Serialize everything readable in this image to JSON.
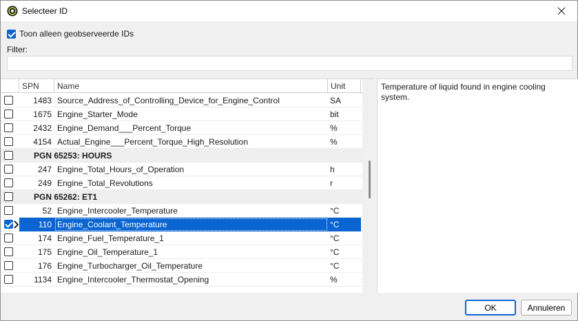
{
  "window": {
    "title": "Selecteer ID"
  },
  "options": {
    "only_observed_label": "Toon alleen geobserveerde IDs",
    "only_observed_checked": true
  },
  "filter": {
    "label": "Filter:",
    "value": ""
  },
  "grid": {
    "columns": {
      "spn": "SPN",
      "name": "Name",
      "unit": "Unit"
    },
    "rows": [
      {
        "kind": "item",
        "checked": false,
        "spn": "1483",
        "name": "Source_Address_of_Controlling_Device_for_Engine_Control",
        "unit": "SA"
      },
      {
        "kind": "item",
        "checked": false,
        "spn": "1675",
        "name": "Engine_Starter_Mode",
        "unit": "bit"
      },
      {
        "kind": "item",
        "checked": false,
        "spn": "2432",
        "name": "Engine_Demand___Percent_Torque",
        "unit": "%"
      },
      {
        "kind": "item",
        "checked": false,
        "spn": "4154",
        "name": "Actual_Engine___Percent_Torque_High_Resolution",
        "unit": "%"
      },
      {
        "kind": "group",
        "checked": false,
        "label": "PGN 65253: HOURS"
      },
      {
        "kind": "item",
        "checked": false,
        "spn": "247",
        "name": "Engine_Total_Hours_of_Operation",
        "unit": "h"
      },
      {
        "kind": "item",
        "checked": false,
        "spn": "249",
        "name": "Engine_Total_Revolutions",
        "unit": "r"
      },
      {
        "kind": "group",
        "checked": false,
        "label": "PGN 65262: ET1"
      },
      {
        "kind": "item",
        "checked": false,
        "spn": "52",
        "name": "Engine_Intercooler_Temperature",
        "unit": "°C"
      },
      {
        "kind": "item",
        "checked": true,
        "selected": true,
        "spn": "110",
        "name": "Engine_Coolant_Temperature",
        "unit": "°C"
      },
      {
        "kind": "item",
        "checked": false,
        "spn": "174",
        "name": "Engine_Fuel_Temperature_1",
        "unit": "°C"
      },
      {
        "kind": "item",
        "checked": false,
        "spn": "175",
        "name": "Engine_Oil_Temperature_1",
        "unit": "°C"
      },
      {
        "kind": "item",
        "checked": false,
        "spn": "176",
        "name": "Engine_Turbocharger_Oil_Temperature",
        "unit": "°C"
      },
      {
        "kind": "item",
        "checked": false,
        "spn": "1134",
        "name": "Engine_Intercooler_Thermostat_Opening",
        "unit": "%"
      }
    ]
  },
  "description": {
    "text": "Temperature of liquid found in engine cooling system."
  },
  "buttons": {
    "ok": "OK",
    "cancel": "Annuleren"
  },
  "icons": {
    "app": "app-logo-icon",
    "close": "close-icon",
    "row_pointer": "row-pointer-icon"
  },
  "colors": {
    "selection": "#0a64d2",
    "group_bg": "#efefef"
  }
}
